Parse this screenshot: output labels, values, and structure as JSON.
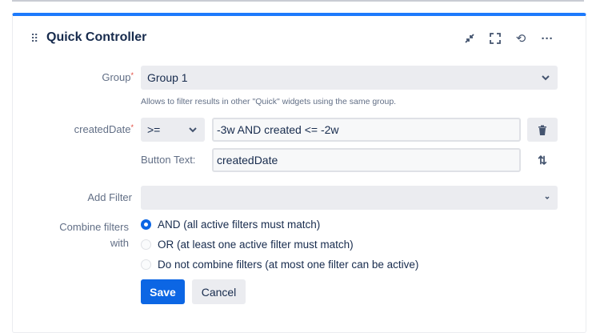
{
  "widget": {
    "title": "Quick Controller",
    "header_icons": [
      "collapse-icon",
      "fullscreen-icon",
      "refresh-icon",
      "more-icon"
    ]
  },
  "form": {
    "group": {
      "label": "Group",
      "value": "Group 1",
      "help": "Allows to filter results in other \"Quick\" widgets using the same group."
    },
    "created_date": {
      "label": "createdDate",
      "operator": ">=",
      "value": "-3w AND created <= -2w",
      "button_text_label": "Button Text:",
      "button_text_value": "createdDate"
    },
    "add_filter": {
      "label": "Add Filter",
      "value": ""
    },
    "combine": {
      "label_line1": "Combine filters",
      "label_line2": "with",
      "options": [
        {
          "label": "AND (all active filters must match)",
          "selected": true
        },
        {
          "label": "OR (at least one active filter must match)",
          "selected": false
        },
        {
          "label": "Do not combine filters (at most one filter can be active)",
          "selected": false
        }
      ]
    },
    "save_label": "Save",
    "cancel_label": "Cancel"
  },
  "colors": {
    "accent": "#0c66e4",
    "top_border": "#1d7afc"
  }
}
